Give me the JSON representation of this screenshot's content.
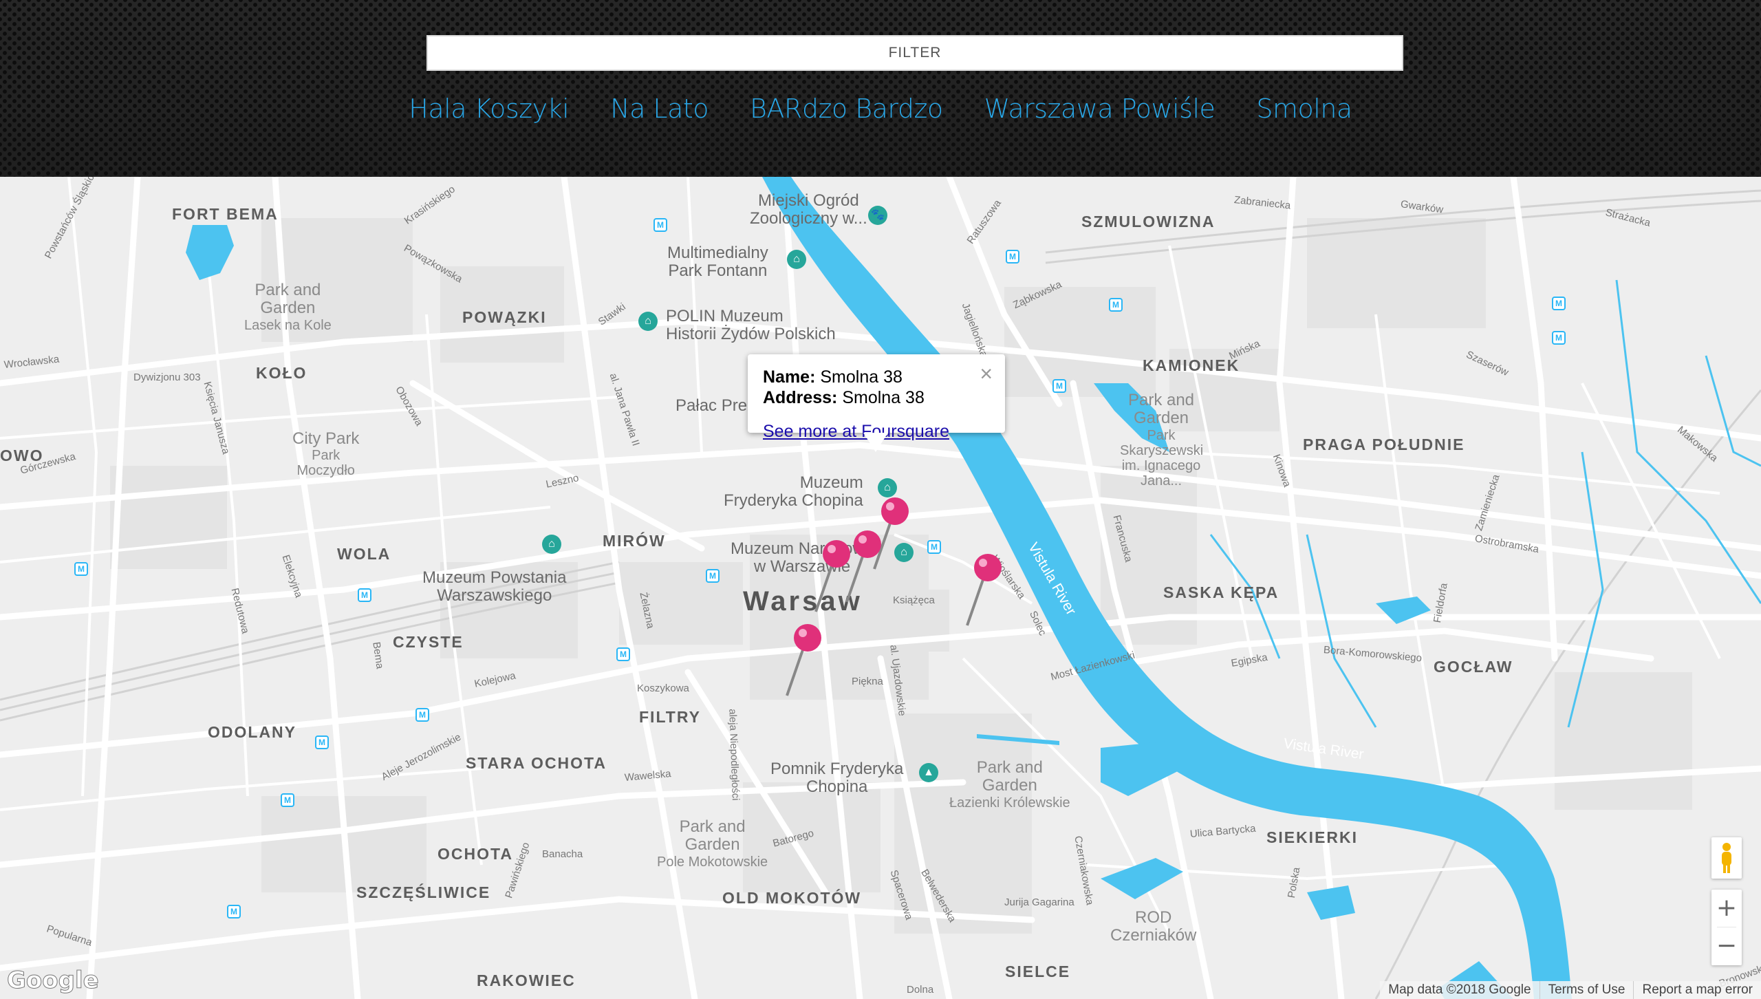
{
  "filter": {
    "placeholder": "FILTER",
    "value": ""
  },
  "places": [
    "Hala Koszyki",
    "Na Lato",
    "BARdzo Bardzo",
    "Warszawa Powiśle",
    "Smolna"
  ],
  "colors": {
    "link": "#29a6e6",
    "water": "#4cc3f0",
    "pin": "#e0307a",
    "road": "#ffffff",
    "map_bg": "#eeeeee"
  },
  "map": {
    "city": "Warsaw",
    "districts": [
      "FORT BEMA",
      "POWĄZKI",
      "KOŁO",
      "WOLA",
      "MIRÓW",
      "CZYSTE",
      "ODOLANY",
      "STARA OCHOTA",
      "FILTRY",
      "OCHOTA",
      "SZCZĘŚLIWICE",
      "RAKOWIEC",
      "OLD MOKOTÓW",
      "SIELCE",
      "SZMULOWIZNA",
      "KAMIONEK",
      "PRAGA POŁUDNIE",
      "SASKA KĘPA",
      "GOCŁAW",
      "SIEKIERKI",
      "OWO"
    ],
    "pois": [
      {
        "l1": "Miejski Ogród",
        "l2": "Zoologiczny w..."
      },
      {
        "l1": "Multimedialny",
        "l2": "Park Fontann"
      },
      {
        "l1": "POLIN Muzeum",
        "l2": "Historii Żydów Polskich"
      },
      {
        "l1": "Pałac Pre",
        "l2": ""
      },
      {
        "l1": "Muzeum",
        "l2": "Fryderyka Chopina"
      },
      {
        "l1": "Muzeum Narodowe",
        "l2": "w Warszawie"
      },
      {
        "l1": "Muzeum Powstania",
        "l2": "Warszawskiego"
      },
      {
        "l1": "Pomnik Fryderyka",
        "l2": "Chopina"
      }
    ],
    "parks": [
      {
        "l1": "Park and",
        "l2": "Garden",
        "l3": "Lasek na Kole"
      },
      {
        "l1": "City Park",
        "l2": "Park",
        "l3": "Moczydło"
      },
      {
        "l1": "Park and",
        "l2": "Garden",
        "l3": "Park Skaryszewski im. Ignacego Jana..."
      },
      {
        "l1": "Park and",
        "l2": "Garden",
        "l3": "Łazienki Królewskie"
      },
      {
        "l1": "Park and",
        "l2": "Garden",
        "l3": "Pole Mokotowskie"
      },
      {
        "l1": "ROD",
        "l2": "Czerniaków",
        "l3": ""
      }
    ],
    "streets": [
      "Powstańców Śląskich",
      "Krasińskiego",
      "Powązkowska",
      "Stawki",
      "Wrocławska",
      "Dywizjonu 303",
      "Księcia Janusza",
      "Obozowa",
      "al. Jana Pawła II",
      "Górczewska",
      "Leszno",
      "Elekcyjna",
      "Redutowa",
      "Żelazna",
      "Bema",
      "Kolejowa",
      "Koszykowa",
      "Piękna",
      "Książęca",
      "al. Ujazdowskie",
      "aleja Niepodległości",
      "Aleje Jerozolimskie",
      "Wawelska",
      "Banacha",
      "Batorego",
      "Pawińskiego",
      "Popularna",
      "Jurija Gagarina",
      "Spacerowa",
      "Belwederska",
      "Dolna",
      "Zabraniecka",
      "Gwarków",
      "Strażacka",
      "Ratuszowa",
      "Ząbkowska",
      "Jagiellońska",
      "Mińska",
      "Szaserów",
      "Kinowa",
      "Makowska",
      "Francuska",
      "Zamieniecka",
      "Ostrobramska",
      "Fieldorfa",
      "Wioślarska",
      "Solec",
      "Most Łazienkowski",
      "Egipska",
      "Bora-Komorowskiego",
      "Ulica Bartycka",
      "Czerniakowska",
      "Polska",
      "Bronowska"
    ],
    "rivers": [
      "Vistula River",
      "Vistula River"
    ]
  },
  "infowindow": {
    "name_label": "Name:",
    "name_value": "Smolna 38",
    "address_label": "Address:",
    "address_value": "Smolna 38",
    "link_text": "See more at Foursquare",
    "close": "×"
  },
  "controls": {
    "zoom_in": "+",
    "zoom_out": "−"
  },
  "attribution": {
    "logo": "Google",
    "map_data": "Map data ©2018 Google",
    "terms": "Terms of Use",
    "report": "Report a map error"
  }
}
